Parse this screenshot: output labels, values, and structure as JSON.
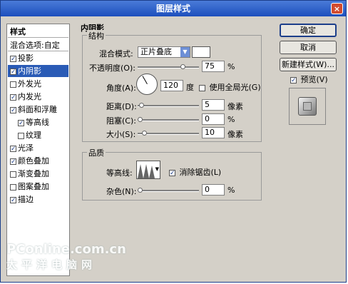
{
  "window": {
    "title": "图层样式",
    "close_glyph": "×"
  },
  "left_panel": {
    "header": "样式",
    "items": [
      {
        "label": "混合选项:自定",
        "check": "none",
        "selected": false
      },
      {
        "label": "投影",
        "check": "checked",
        "selected": false
      },
      {
        "label": "内阴影",
        "check": "checked",
        "selected": true
      },
      {
        "label": "外发光",
        "check": "unchecked",
        "selected": false
      },
      {
        "label": "内发光",
        "check": "checked",
        "selected": false
      },
      {
        "label": "斜面和浮雕",
        "check": "checked",
        "selected": false
      },
      {
        "label": "等高线",
        "check": "checked",
        "selected": false,
        "indent": true
      },
      {
        "label": "纹理",
        "check": "unchecked",
        "selected": false,
        "indent": true
      },
      {
        "label": "光泽",
        "check": "checked",
        "selected": false
      },
      {
        "label": "颜色叠加",
        "check": "checked",
        "selected": false
      },
      {
        "label": "渐变叠加",
        "check": "unchecked",
        "selected": false
      },
      {
        "label": "图案叠加",
        "check": "unchecked",
        "selected": false
      },
      {
        "label": "描边",
        "check": "checked",
        "selected": false
      }
    ]
  },
  "section_title": "内阴影",
  "structure": {
    "legend": "结构",
    "blend_mode_label": "混合模式:",
    "blend_mode_value": "正片叠底",
    "opacity_label": "不透明度(O):",
    "opacity_value": "75",
    "opacity_unit": "%",
    "angle_label": "角度(A):",
    "angle_value": "120",
    "angle_unit": "度",
    "global_light_label": "使用全局光(G)",
    "distance_label": "距离(D):",
    "distance_value": "5",
    "distance_unit": "像素",
    "choke_label": "阻塞(C):",
    "choke_value": "0",
    "choke_unit": "%",
    "size_label": "大小(S):",
    "size_value": "10",
    "size_unit": "像素"
  },
  "quality": {
    "legend": "品质",
    "contour_label": "等高线:",
    "antialias_label": "消除锯齿(L)",
    "noise_label": "杂色(N):",
    "noise_value": "0",
    "noise_unit": "%"
  },
  "buttons": {
    "ok": "确定",
    "cancel": "取消",
    "new_style": "新建样式(W)...",
    "preview": "预览(V)"
  },
  "watermark": {
    "brand": "PConline.com.cn",
    "sub": "太平洋电脑网"
  },
  "colors": {
    "titlebar": "#1d4fbd",
    "selected": "#2a5bb6",
    "dialog": "#d4d0c8"
  }
}
